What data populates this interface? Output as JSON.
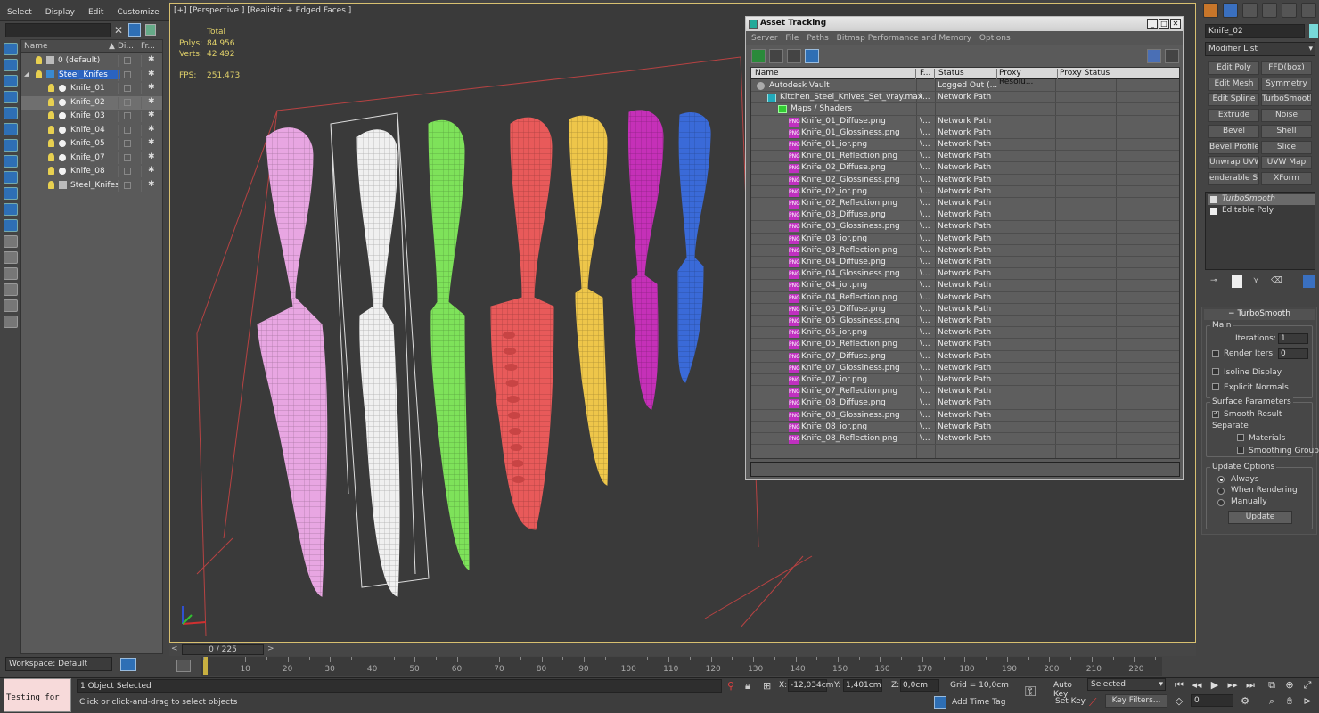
{
  "menu": {
    "items": [
      "Select",
      "Display",
      "Edit",
      "Customize"
    ]
  },
  "explorer": {
    "columns": {
      "name": "Name",
      "display": "Di...",
      "freeze": "Fr..."
    },
    "rows": [
      {
        "label": "0 (default)",
        "kind": "layer"
      },
      {
        "label": "Steel_Knifes",
        "kind": "layer",
        "selected": true
      },
      {
        "label": "Knife_01",
        "kind": "object"
      },
      {
        "label": "Knife_02",
        "kind": "object",
        "highlight": true
      },
      {
        "label": "Knife_03",
        "kind": "object"
      },
      {
        "label": "Knife_04",
        "kind": "object"
      },
      {
        "label": "Knife_05",
        "kind": "object"
      },
      {
        "label": "Knife_07",
        "kind": "object"
      },
      {
        "label": "Knife_08",
        "kind": "object"
      },
      {
        "label": "Steel_Knifes",
        "kind": "object"
      }
    ],
    "workspace": "Workspace: Default"
  },
  "viewport": {
    "label": "[+] [Perspective ] [Realistic + Edged Faces ]",
    "stats": {
      "total_label": "Total",
      "polys_label": "Polys:",
      "polys": "84 956",
      "verts_label": "Verts:",
      "verts": "42 492",
      "fps_label": "FPS:",
      "fps": "251,473"
    },
    "knife_colors": [
      "#e8a6e2",
      "#f0f0f0",
      "#7ee25a",
      "#e85a5a",
      "#eec64a",
      "#c530b8",
      "#3a6ad8"
    ]
  },
  "asset": {
    "title": "Asset Tracking",
    "menu": [
      "Server",
      "File",
      "Paths",
      "Bitmap Performance and Memory",
      "Options"
    ],
    "columns": [
      "Name",
      "F...",
      "Status",
      "Proxy Resolu...",
      "Proxy Status"
    ],
    "rows": [
      {
        "name": "Autodesk Vault",
        "f": "",
        "status": "Logged Out (...",
        "indent": 1,
        "icon": "vault"
      },
      {
        "name": "Kitchen_Steel_Knives_Set_vray.max",
        "f": "\\...",
        "status": "Network Path",
        "indent": 2,
        "icon": "max"
      },
      {
        "name": "Maps / Shaders",
        "f": "",
        "status": "",
        "indent": 3,
        "icon": "maps"
      },
      {
        "name": "Knife_01_Diffuse.png",
        "f": "\\...",
        "status": "Network Path",
        "indent": 4,
        "icon": "png"
      },
      {
        "name": "Knife_01_Glossiness.png",
        "f": "\\...",
        "status": "Network Path",
        "indent": 4,
        "icon": "png"
      },
      {
        "name": "Knife_01_ior.png",
        "f": "\\...",
        "status": "Network Path",
        "indent": 4,
        "icon": "png"
      },
      {
        "name": "Knife_01_Reflection.png",
        "f": "\\...",
        "status": "Network Path",
        "indent": 4,
        "icon": "png"
      },
      {
        "name": "Knife_02_Diffuse.png",
        "f": "\\...",
        "status": "Network Path",
        "indent": 4,
        "icon": "png"
      },
      {
        "name": "Knife_02_Glossiness.png",
        "f": "\\...",
        "status": "Network Path",
        "indent": 4,
        "icon": "png"
      },
      {
        "name": "Knife_02_ior.png",
        "f": "\\...",
        "status": "Network Path",
        "indent": 4,
        "icon": "png"
      },
      {
        "name": "Knife_02_Reflection.png",
        "f": "\\...",
        "status": "Network Path",
        "indent": 4,
        "icon": "png"
      },
      {
        "name": "Knife_03_Diffuse.png",
        "f": "\\...",
        "status": "Network Path",
        "indent": 4,
        "icon": "png"
      },
      {
        "name": "Knife_03_Glossiness.png",
        "f": "\\...",
        "status": "Network Path",
        "indent": 4,
        "icon": "png"
      },
      {
        "name": "Knife_03_ior.png",
        "f": "\\...",
        "status": "Network Path",
        "indent": 4,
        "icon": "png"
      },
      {
        "name": "Knife_03_Reflection.png",
        "f": "\\...",
        "status": "Network Path",
        "indent": 4,
        "icon": "png"
      },
      {
        "name": "Knife_04_Diffuse.png",
        "f": "\\...",
        "status": "Network Path",
        "indent": 4,
        "icon": "png"
      },
      {
        "name": "Knife_04_Glossiness.png",
        "f": "\\...",
        "status": "Network Path",
        "indent": 4,
        "icon": "png"
      },
      {
        "name": "Knife_04_ior.png",
        "f": "\\...",
        "status": "Network Path",
        "indent": 4,
        "icon": "png"
      },
      {
        "name": "Knife_04_Reflection.png",
        "f": "\\...",
        "status": "Network Path",
        "indent": 4,
        "icon": "png"
      },
      {
        "name": "Knife_05_Diffuse.png",
        "f": "\\...",
        "status": "Network Path",
        "indent": 4,
        "icon": "png"
      },
      {
        "name": "Knife_05_Glossiness.png",
        "f": "\\...",
        "status": "Network Path",
        "indent": 4,
        "icon": "png"
      },
      {
        "name": "Knife_05_ior.png",
        "f": "\\...",
        "status": "Network Path",
        "indent": 4,
        "icon": "png"
      },
      {
        "name": "Knife_05_Reflection.png",
        "f": "\\...",
        "status": "Network Path",
        "indent": 4,
        "icon": "png"
      },
      {
        "name": "Knife_07_Diffuse.png",
        "f": "\\...",
        "status": "Network Path",
        "indent": 4,
        "icon": "png"
      },
      {
        "name": "Knife_07_Glossiness.png",
        "f": "\\...",
        "status": "Network Path",
        "indent": 4,
        "icon": "png"
      },
      {
        "name": "Knife_07_ior.png",
        "f": "\\...",
        "status": "Network Path",
        "indent": 4,
        "icon": "png"
      },
      {
        "name": "Knife_07_Reflection.png",
        "f": "\\...",
        "status": "Network Path",
        "indent": 4,
        "icon": "png"
      },
      {
        "name": "Knife_08_Diffuse.png",
        "f": "\\...",
        "status": "Network Path",
        "indent": 4,
        "icon": "png"
      },
      {
        "name": "Knife_08_Glossiness.png",
        "f": "\\...",
        "status": "Network Path",
        "indent": 4,
        "icon": "png"
      },
      {
        "name": "Knife_08_ior.png",
        "f": "\\...",
        "status": "Network Path",
        "indent": 4,
        "icon": "png"
      },
      {
        "name": "Knife_08_Reflection.png",
        "f": "\\...",
        "status": "Network Path",
        "indent": 4,
        "icon": "png"
      }
    ],
    "png_badge": "PNG"
  },
  "command": {
    "object_name": "Knife_02",
    "object_color": "#78d8d8",
    "modifier_list": "Modifier List",
    "modifier_buttons": [
      "Edit Poly",
      "FFD(box)",
      "Edit Mesh",
      "Symmetry",
      "Edit Spline",
      "TurboSmooth",
      "Extrude",
      "Noise",
      "Bevel",
      "Shell",
      "Bevel Profile",
      "Slice",
      "Unwrap UVW",
      "UVW Map",
      "enderable Splin",
      "XForm"
    ],
    "stack": [
      {
        "label": "TurboSmooth",
        "selected": true
      },
      {
        "label": "Editable Poly",
        "selected": false
      }
    ],
    "turbosmooth": {
      "title": "TurboSmooth",
      "main": "Main",
      "iterations_label": "Iterations:",
      "iterations": "1",
      "render_iters_label": "Render Iters:",
      "render_iters": "0",
      "isoline": "Isoline Display",
      "explicit": "Explicit Normals",
      "surface": "Surface Parameters",
      "smooth_result": "Smooth Result",
      "separate": "Separate",
      "materials": "Materials",
      "smoothing_groups": "Smoothing Groups",
      "update_options": "Update Options",
      "always": "Always",
      "when_rendering": "When Rendering",
      "manually": "Manually",
      "update": "Update"
    }
  },
  "timeline": {
    "slider_label": "0 / 225",
    "ticks": [
      10,
      20,
      30,
      40,
      50,
      60,
      70,
      80,
      90,
      100,
      110,
      120,
      130,
      140,
      150,
      160,
      170,
      180,
      190,
      200,
      210,
      220
    ]
  },
  "status": {
    "testing": "Testing for",
    "selected": "1 Object Selected",
    "prompt": "Click or click-and-drag to select objects",
    "x_label": "X:",
    "x": "-12,034cm",
    "y_label": "Y:",
    "y": "1,401cm",
    "z_label": "Z:",
    "z": "0,0cm",
    "grid": "Grid = 10,0cm",
    "add_time_tag": "Add Time Tag",
    "auto_key": "Auto Key",
    "set_key": "Set Key",
    "selected_mode": "Selected",
    "key_filters": "Key Filters...",
    "frame": "0"
  }
}
